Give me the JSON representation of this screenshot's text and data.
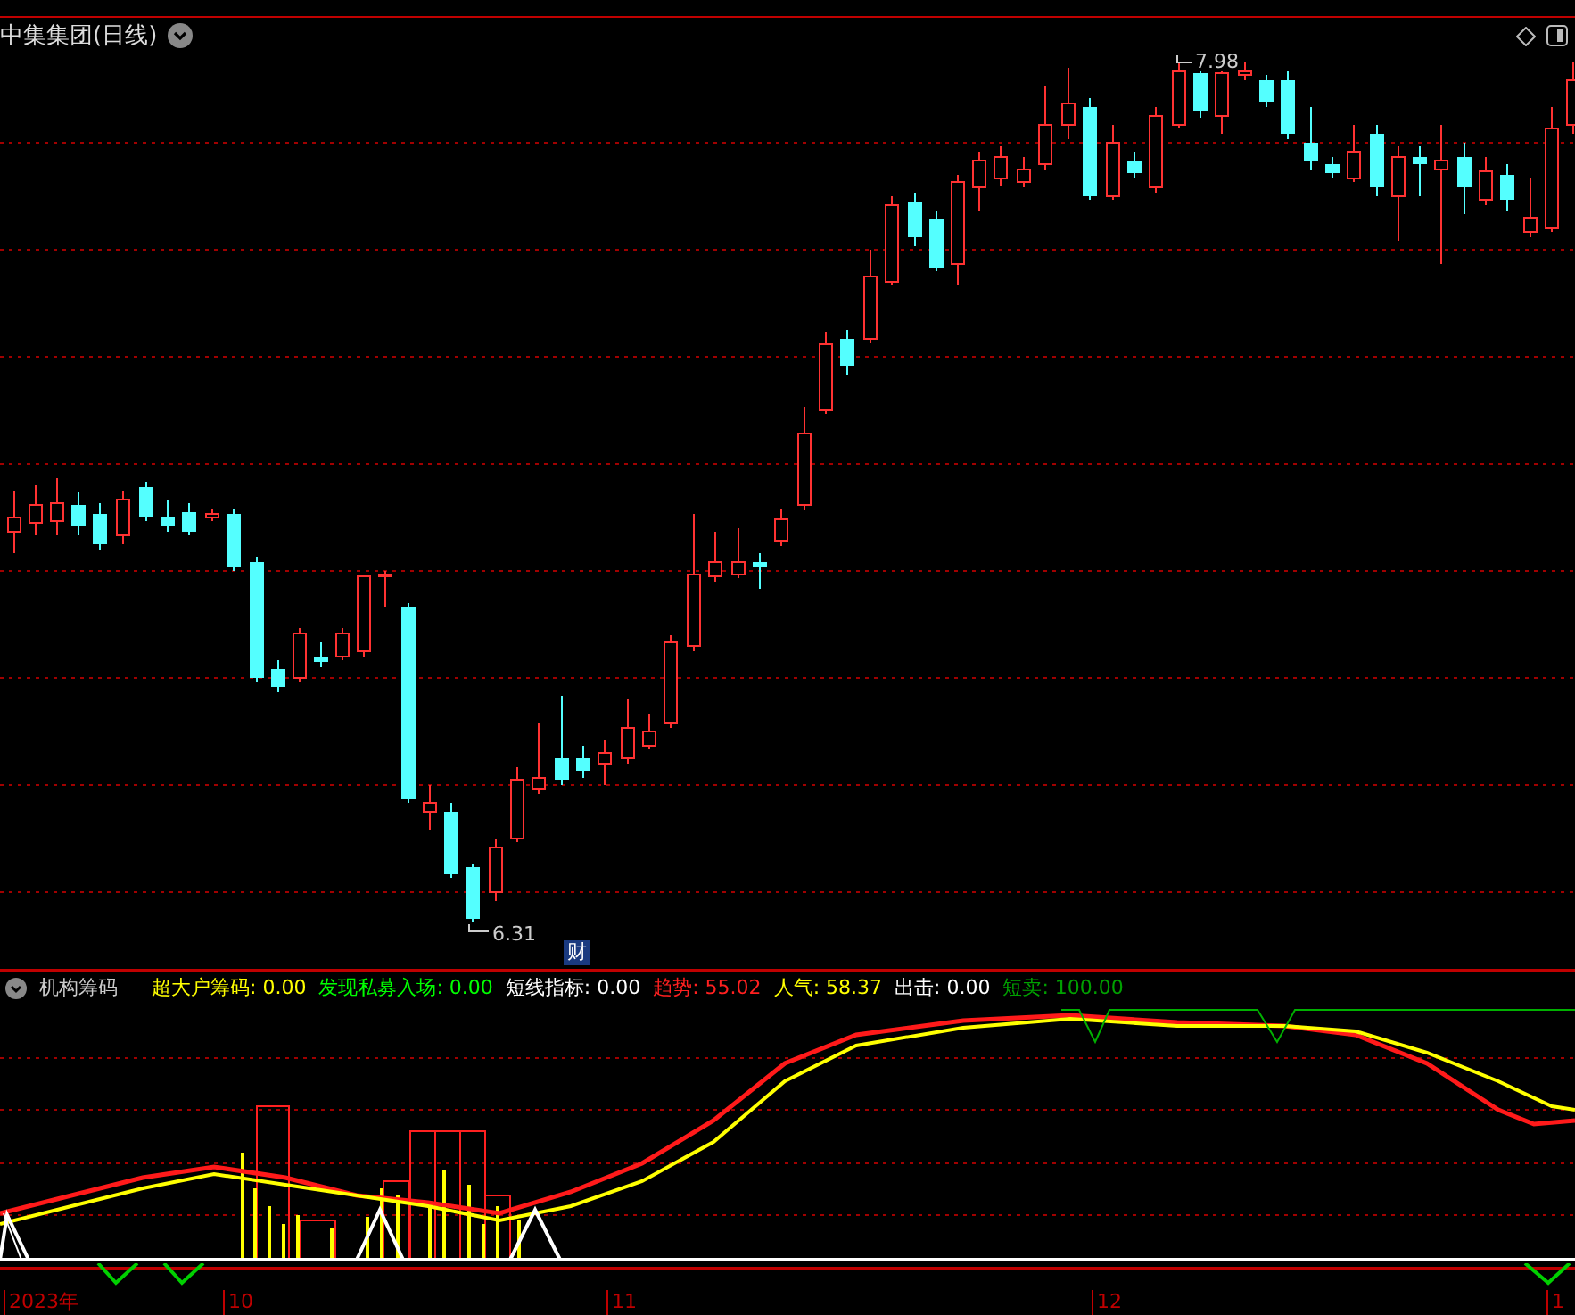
{
  "chart": {
    "title": "中集集团(日线)",
    "high_label": "7.98",
    "low_label": "6.31",
    "event_badge": "财"
  },
  "indicator": {
    "name": "机构筹码",
    "readouts": [
      {
        "label": "超大户筹码:",
        "value": "0.00",
        "color": "#ffff00"
      },
      {
        "label": "发现私募入场:",
        "value": "0.00",
        "color": "#00ff00"
      },
      {
        "label": "短线指标:",
        "value": "0.00",
        "color": "#ffffff"
      },
      {
        "label": "趋势:",
        "value": "55.02",
        "color": "#ff2020"
      },
      {
        "label": "人气:",
        "value": "58.37",
        "color": "#ffff00"
      },
      {
        "label": "出击:",
        "value": "0.00",
        "color": "#ffffff"
      },
      {
        "label": "短卖:",
        "value": "100.00",
        "color": "#00a000"
      }
    ]
  },
  "x_axis": {
    "labels": [
      "2023年",
      "10",
      "11",
      "12",
      "1"
    ]
  }
}
